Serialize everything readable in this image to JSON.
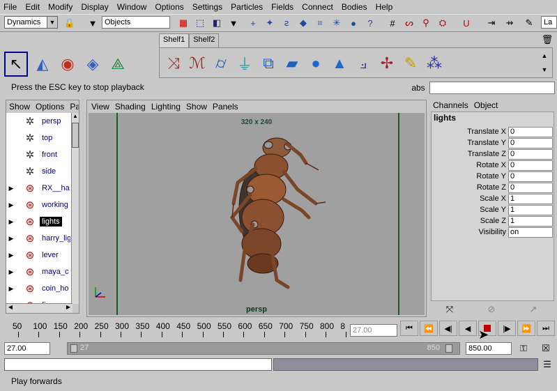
{
  "menu": [
    "File",
    "Edit",
    "Modify",
    "Display",
    "Window",
    "Options",
    "Settings",
    "Particles",
    "Fields",
    "Connect",
    "Bodies",
    "Help"
  ],
  "toolbar": {
    "mode": "Dynamics",
    "selection_field": "Objects",
    "right_field": "La"
  },
  "shelf": {
    "tabs": [
      "Shelf1",
      "Shelf2"
    ],
    "active_tab": "Shelf1"
  },
  "help_line": "Press the ESC key to stop playback",
  "abs_label": "abs",
  "outliner": {
    "menu": [
      "Show",
      "Options",
      "Par"
    ],
    "items": [
      {
        "label": "persp",
        "icon": "camera-icon",
        "expandable": false,
        "selected": false
      },
      {
        "label": "top",
        "icon": "camera-icon",
        "expandable": false,
        "selected": false
      },
      {
        "label": "front",
        "icon": "camera-icon",
        "expandable": false,
        "selected": false
      },
      {
        "label": "side",
        "icon": "camera-icon",
        "expandable": false,
        "selected": false
      },
      {
        "label": "RX__ha",
        "icon": "transform-icon",
        "expandable": true,
        "selected": false
      },
      {
        "label": "working",
        "icon": "transform-icon",
        "expandable": true,
        "selected": false
      },
      {
        "label": "lights",
        "icon": "transform-icon",
        "expandable": true,
        "selected": true
      },
      {
        "label": "harry_lig",
        "icon": "transform-icon",
        "expandable": true,
        "selected": false
      },
      {
        "label": "lever",
        "icon": "transform-icon",
        "expandable": true,
        "selected": false
      },
      {
        "label": "maya_c",
        "icon": "transform-icon",
        "expandable": true,
        "selected": false
      },
      {
        "label": "coin_ho",
        "icon": "transform-icon",
        "expandable": true,
        "selected": false
      },
      {
        "label": "fins",
        "icon": "transform-icon",
        "expandable": true,
        "selected": false
      }
    ]
  },
  "viewport": {
    "menu": [
      "View",
      "Shading",
      "Lighting",
      "Show",
      "Panels"
    ],
    "resolution": "320 x 240",
    "camera": "persp"
  },
  "channel_box": {
    "menu": [
      "Channels",
      "Object"
    ],
    "object": "lights",
    "channels": [
      {
        "name": "Translate X",
        "value": "0"
      },
      {
        "name": "Translate Y",
        "value": "0"
      },
      {
        "name": "Translate Z",
        "value": "0"
      },
      {
        "name": "Rotate X",
        "value": "0"
      },
      {
        "name": "Rotate Y",
        "value": "0"
      },
      {
        "name": "Rotate Z",
        "value": "0"
      },
      {
        "name": "Scale X",
        "value": "1"
      },
      {
        "name": "Scale Y",
        "value": "1"
      },
      {
        "name": "Scale Z",
        "value": "1"
      },
      {
        "name": "Visibility",
        "value": "on"
      }
    ]
  },
  "timeline": {
    "ticks": [
      "50",
      "100",
      "150",
      "200",
      "250",
      "300",
      "350",
      "400",
      "450",
      "500",
      "550",
      "600",
      "650",
      "700",
      "750",
      "800",
      "8"
    ],
    "current_frame_field": "27.00"
  },
  "range": {
    "start": "27.00",
    "range_start_label": "27",
    "range_end_label": "850",
    "end": "850.00"
  },
  "status_line": "Play forwards",
  "colors": {
    "ui_gray": "#c8c8c8",
    "viewport_bg": "#a0a0a0",
    "selection": "#000000",
    "outliner_text": "#000080",
    "cmd_result": "#8e8e9e"
  }
}
